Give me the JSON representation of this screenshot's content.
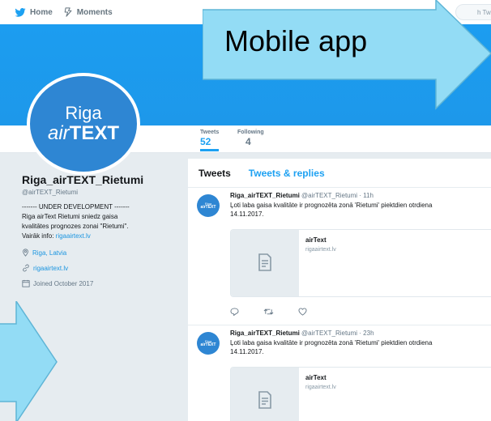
{
  "nav": {
    "home_label": "Home",
    "moments_label": "Moments",
    "search_placeholder": "h Twi"
  },
  "colors": {
    "twitter_blue": "#1da1f2",
    "avatar_blue": "#2e86d3",
    "callout_blue": "#93dcf5"
  },
  "avatar": {
    "line1": "Riga",
    "line2_prefix": "air",
    "line2_suffix": "TEXT"
  },
  "stats": [
    {
      "label": "Tweets",
      "value": "52"
    },
    {
      "label": "Following",
      "value": "4"
    }
  ],
  "profile": {
    "name": "Riga_airTEXT_Rietumi",
    "handle": "@airTEXT_Rietumi",
    "bio_line1": "------- UNDER DEVELOPMENT -------",
    "bio_line2": "Riga airText Rietumi sniedz gaisa",
    "bio_line3": "kvalitātes prognozes zonai \"Rietumi\".",
    "bio_line4_prefix": "Vairāk info: ",
    "bio_link": "rigaairtext.lv",
    "location": "Riga, Latvia",
    "website": "rigaairtext.lv",
    "joined": "Joined October 2017"
  },
  "timeline": {
    "tab_tweets": "Tweets",
    "tab_replies": "Tweets & replies",
    "tweets": [
      {
        "avatar_line1": "Riga",
        "avatar_line2": "airTEXT",
        "name": "Riga_airTEXT_Rietumi",
        "handle_time": "@airTEXT_Rietumi · 11h",
        "text_line1": "Ļoti laba gaisa kvalitāte ir prognozēta zonā 'Rietumi' piektdien otrdiena",
        "text_line2": "14.11.2017.",
        "card_title": "airText",
        "card_url": "rigaairtext.lv"
      },
      {
        "avatar_line1": "Riga",
        "avatar_line2": "airTEXT",
        "name": "Riga_airTEXT_Rietumi",
        "handle_time": "@airTEXT_Rietumi · 23h",
        "text_line1": "Ļoti laba gaisa kvalitāte ir prognozēta zonā 'Rietumi' piektdien otrdiena",
        "text_line2": "14.11.2017.",
        "card_title": "airText",
        "card_url": "rigaairtext.lv"
      }
    ]
  },
  "callout": {
    "label": "Mobile app"
  }
}
